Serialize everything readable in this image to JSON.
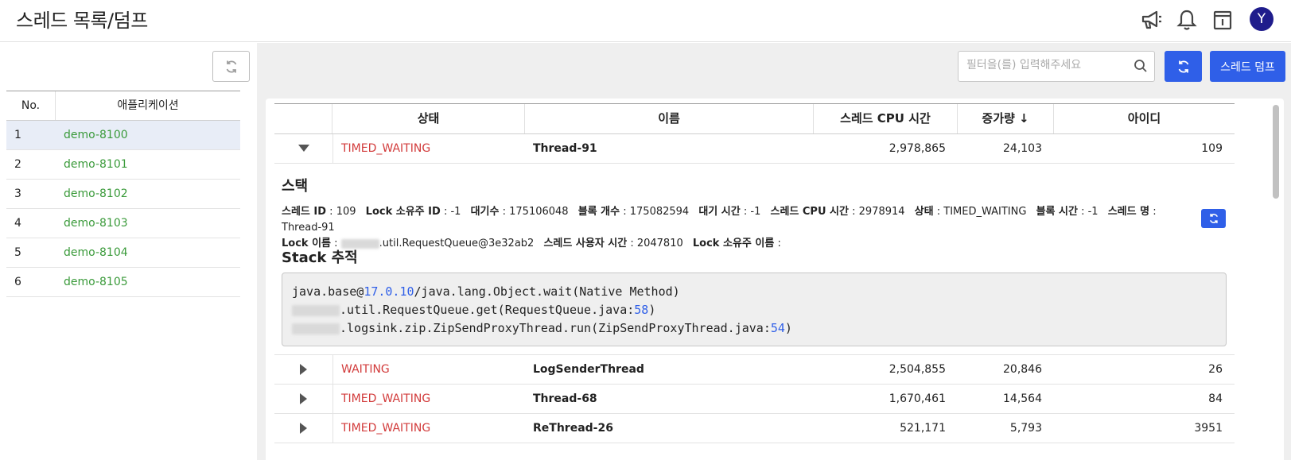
{
  "header": {
    "title": "스레드 목록/덤프",
    "avatar_initial": "Y",
    "icons": [
      "megaphone-icon",
      "bell-icon",
      "info-panel-icon"
    ]
  },
  "left_panel": {
    "columns": {
      "no": "No.",
      "app": "애플리케이션"
    },
    "rows": [
      {
        "no": "1",
        "name": "demo-8100",
        "selected": true
      },
      {
        "no": "2",
        "name": "demo-8101",
        "selected": false
      },
      {
        "no": "3",
        "name": "demo-8102",
        "selected": false
      },
      {
        "no": "4",
        "name": "demo-8103",
        "selected": false
      },
      {
        "no": "5",
        "name": "demo-8104",
        "selected": false
      },
      {
        "no": "6",
        "name": "demo-8105",
        "selected": false
      }
    ]
  },
  "toolbar": {
    "search_placeholder": "필터을(를) 입력해주세요",
    "dump_label": "스레드 덤프"
  },
  "threads": {
    "columns": {
      "state": "상태",
      "name": "이름",
      "cpu": "스레드 CPU 시간",
      "inc": "증가량 ↓",
      "id": "아이디"
    },
    "rows": [
      {
        "state": "TIMED_WAITING",
        "name": "Thread-91",
        "cpu": "2,978,865",
        "inc": "24,103",
        "id": "109",
        "expanded": true
      },
      {
        "state": "WAITING",
        "name": "LogSenderThread",
        "cpu": "2,504,855",
        "inc": "20,846",
        "id": "26",
        "expanded": false
      },
      {
        "state": "TIMED_WAITING",
        "name": "Thread-68",
        "cpu": "1,670,461",
        "inc": "14,564",
        "id": "84",
        "expanded": false
      },
      {
        "state": "TIMED_WAITING",
        "name": "ReThread-26",
        "cpu": "521,171",
        "inc": "5,793",
        "id": "3951",
        "expanded": false
      }
    ]
  },
  "detail": {
    "title": "스택",
    "info": [
      {
        "label": "스레드 ID",
        "value": "109"
      },
      {
        "label": "Lock 소유주 ID",
        "value": "-1"
      },
      {
        "label": "대기수",
        "value": "175106048"
      },
      {
        "label": "블록 개수",
        "value": "175082594"
      },
      {
        "label": "대기 시간",
        "value": "-1"
      },
      {
        "label": "스레드 CPU 시간",
        "value": "2978914"
      },
      {
        "label": "상태",
        "value": "TIMED_WAITING"
      },
      {
        "label": "블록 시간",
        "value": "-1"
      },
      {
        "label": "스레드 명",
        "value": "Thread-91"
      }
    ],
    "info2": [
      {
        "label": "Lock 이름",
        "value": ".util.RequestQueue@3e32ab2"
      },
      {
        "label": "스레드 사용자 시간",
        "value": "2047810"
      },
      {
        "label": "Lock 소유주 이름",
        "value": ""
      }
    ],
    "stack_title": "Stack 추적",
    "stack_lines": [
      {
        "pre": "java.base@",
        "num": "17.0.10",
        "post": "/java.lang.Object.wait(Native Method)",
        "blur": false,
        "end_num": "",
        "end": ""
      },
      {
        "pre": "",
        "num": "",
        "post": ".util.RequestQueue.get(RequestQueue.java:",
        "blur": true,
        "end_num": "58",
        "end": ")"
      },
      {
        "pre": "",
        "num": "",
        "post": ".logsink.zip.ZipSendProxyThread.run(ZipSendProxyThread.java:",
        "blur": true,
        "end_num": "54",
        "end": ")"
      }
    ]
  }
}
